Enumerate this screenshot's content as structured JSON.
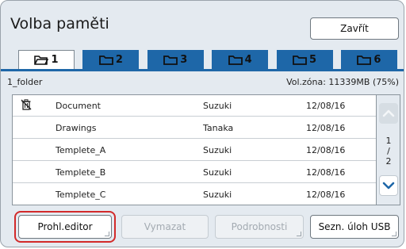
{
  "header": {
    "title": "Volba paměti",
    "close_label": "Zavřít"
  },
  "tabs": [
    {
      "label": "1",
      "active": true
    },
    {
      "label": "2",
      "active": false
    },
    {
      "label": "3",
      "active": false
    },
    {
      "label": "4",
      "active": false
    },
    {
      "label": "5",
      "active": false
    },
    {
      "label": "6",
      "active": false
    }
  ],
  "folder": {
    "name": "1_folder",
    "volume": "Vol.zóna: 11339MB (75%)"
  },
  "list": {
    "rows": [
      {
        "icon": "trash-icon",
        "name": "Document",
        "owner": "Suzuki",
        "date": "12/08/16"
      },
      {
        "icon": "",
        "name": "Drawings",
        "owner": "Tanaka",
        "date": "12/08/16"
      },
      {
        "icon": "",
        "name": "Templete_A",
        "owner": "Suzuki",
        "date": "12/08/16"
      },
      {
        "icon": "",
        "name": "Templete_B",
        "owner": "Suzuki",
        "date": "12/08/16"
      },
      {
        "icon": "",
        "name": "Templete_C",
        "owner": "Suzuki",
        "date": "12/08/16"
      }
    ]
  },
  "pagination": {
    "current": "1",
    "separator": "/",
    "total": "2"
  },
  "buttons": {
    "editor": "Prohl.editor",
    "delete": "Vymazat",
    "details": "Podrobnosti",
    "usb": "Sezn. úloh USB"
  },
  "colors": {
    "accent": "#1e67a8",
    "highlight": "#d22a2a",
    "panel": "#e4eaf0"
  }
}
